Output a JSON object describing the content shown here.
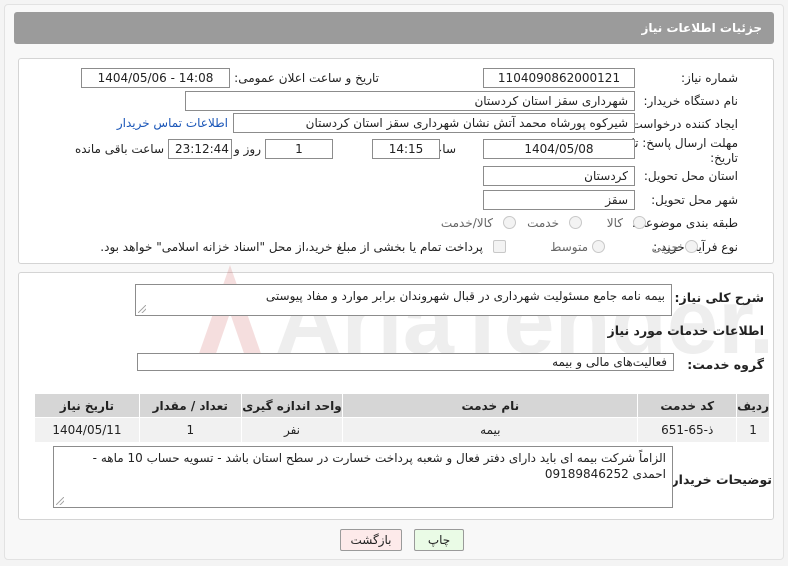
{
  "header": {
    "title": "جزئیات اطلاعات نیاز"
  },
  "form": {
    "need_number": {
      "label": "شماره نیاز:",
      "value": "1104090862000121"
    },
    "announce_datetime": {
      "label": "تاریخ و ساعت اعلان عمومی:",
      "value": "1404/05/06 - 14:08"
    },
    "buyer_org": {
      "label": "نام دستگاه خریدار:",
      "value": "شهرداری سقز استان کردستان"
    },
    "requester": {
      "label": "ایجاد کننده درخواست:",
      "value": "شیرکوه پورشاه محمد آتش نشان شهرداری سقز استان کردستان",
      "contact_link": "اطلاعات تماس خریدار"
    },
    "deadline": {
      "label_line1": "مهلت ارسال پاسخ: تا",
      "label_line2": "تاریخ:",
      "date": "1404/05/08",
      "time_label": "ساعت",
      "time": "14:15",
      "days": "1",
      "days_label": "روز و",
      "remaining": "23:12:44",
      "remaining_label": "ساعت باقی مانده"
    },
    "province": {
      "label": "استان محل تحویل:",
      "value": "کردستان"
    },
    "city": {
      "label": "شهر محل تحویل:",
      "value": "سقز"
    },
    "category": {
      "label": "طبقه بندی موضوعی:",
      "options": [
        "کالا",
        "خدمت",
        "کالا/خدمت"
      ]
    },
    "purchase_type": {
      "label": "نوع فرآیند خرید :",
      "options": [
        "جزیی",
        "متوسط"
      ],
      "payment_note": "پرداخت تمام یا بخشی از مبلغ خرید،از محل \"اسناد خزانه اسلامی\" خواهد بود."
    }
  },
  "summary": {
    "label": "شرح کلی نیاز:",
    "value": "بیمه نامه جامع مسئولیت شهرداری در قبال شهروندان برابر موارد و مفاد پیوستی"
  },
  "services": {
    "heading": "اطلاعات خدمات مورد نیاز",
    "group_label": "گروه خدمت:",
    "group_value": "فعالیت‌های مالی و بیمه",
    "columns": [
      "ردیف",
      "کد خدمت",
      "نام خدمت",
      "واحد اندازه گیری",
      "تعداد / مقدار",
      "تاریخ نیاز"
    ],
    "rows": [
      {
        "row": "1",
        "code": "ذ-65-651",
        "name": "بیمه",
        "unit": "نفر",
        "qty": "1",
        "date": "1404/05/11"
      }
    ]
  },
  "buyer_notes": {
    "label": "توضیحات خریدار:",
    "value": "الزاماً شرکت بیمه ای باید دارای دفتر فعال و شعبه پرداخت خسارت در سطح استان باشد - تسویه حساب 10 ماهه - احمدی 09189846252"
  },
  "buttons": {
    "print": "چاپ",
    "back": "بازگشت"
  },
  "watermark": {
    "text": "AriaTender.neT"
  },
  "colors": {
    "titlebar": "#9b9b9b",
    "link": "#1a56b8",
    "table_header": "#d6d6d6",
    "print_button": "#eafbe6",
    "back_button": "#fdeaea"
  }
}
